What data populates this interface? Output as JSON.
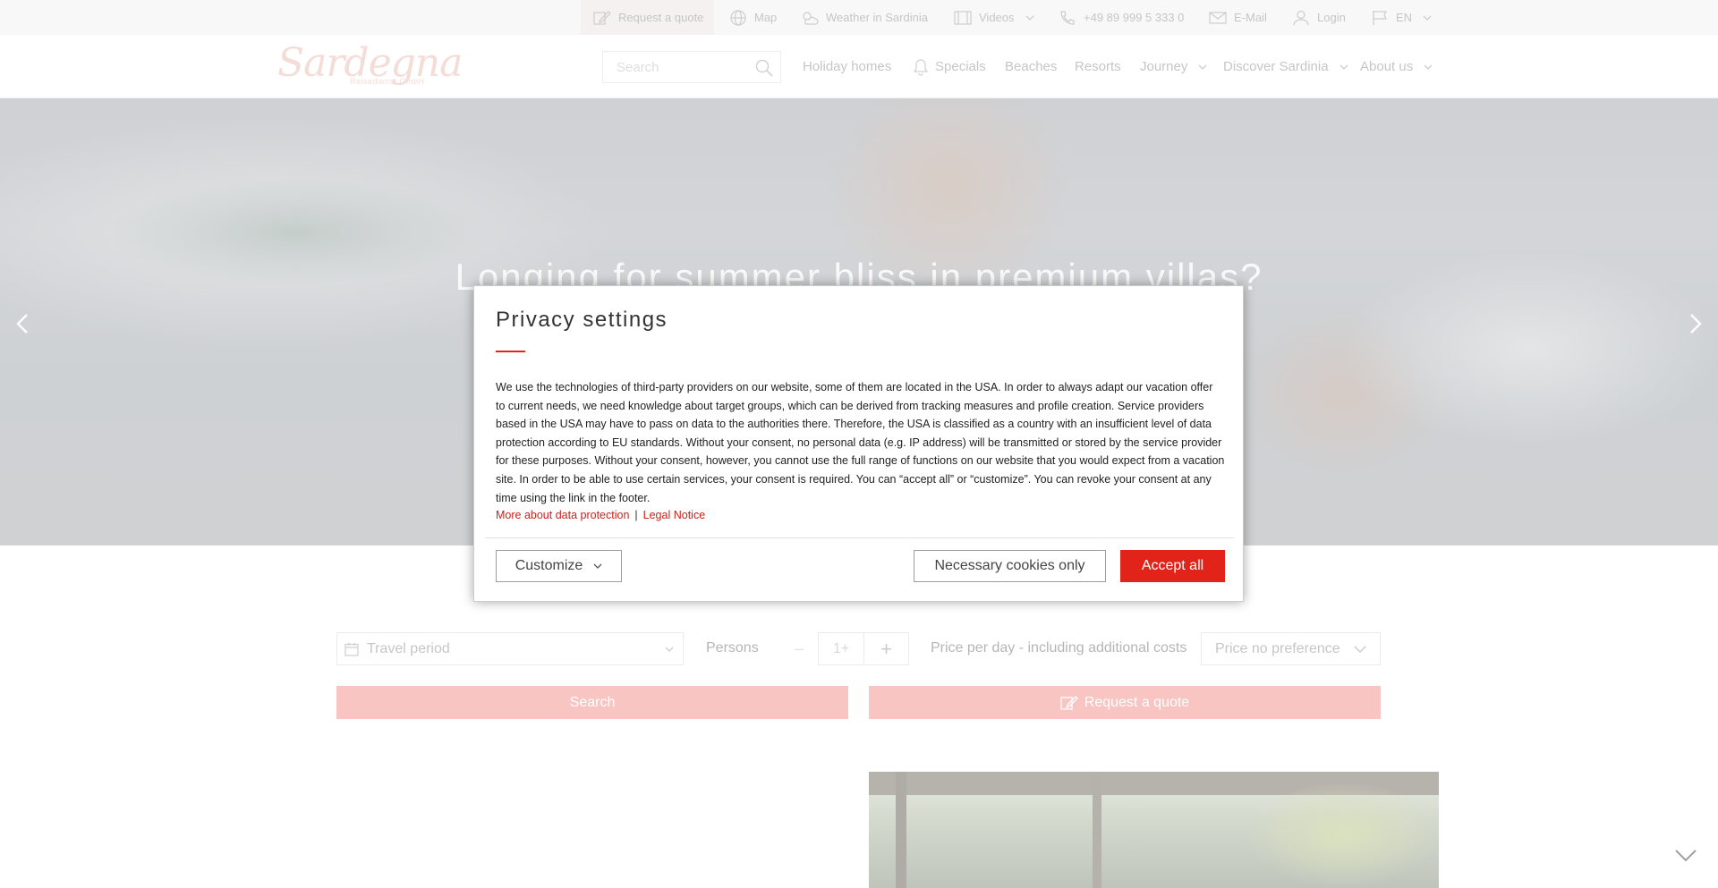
{
  "topbar": {
    "request_quote": "Request a quote",
    "map": "Map",
    "weather": "Weather in Sardinia",
    "videos": "Videos",
    "phone": "+49 89 999 5 333 0",
    "email": "E-Mail",
    "login": "Login",
    "language": "EN"
  },
  "header": {
    "logo_text": "Sardegna",
    "logo_sub": "Reisedienst GmbH",
    "search_placeholder": "Search",
    "nav": {
      "holiday_homes": "Holiday homes",
      "specials": "Specials",
      "beaches": "Beaches",
      "resorts": "Resorts",
      "journey": "Journey",
      "discover": "Discover Sardinia",
      "about": "About us"
    }
  },
  "hero": {
    "headline": "Longing for summer bliss in premium villas?"
  },
  "booking": {
    "travel_period": "Travel period",
    "persons_label": "Persons",
    "minus": "–",
    "persons_value": "1+",
    "plus": "+",
    "price_label": "Price per day - including additional costs",
    "price_select": "Price no preference",
    "search_button": "Search",
    "quote_button": "Request a quote"
  },
  "modal": {
    "title": "Privacy settings",
    "body": "We use the technologies of third-party providers on our website, some of them are located in the USA. In order to always adapt our vacation offer to current needs, we need knowledge about target groups, which can be derived from tracking measures and profile creation. Service providers based in the USA may have to pass on data to the authorities there. Therefore, the USA is classified as a country with an insufficient level of data protection according to EU standards. Without your consent, no personal data (e.g. IP address) will be transmitted or stored by the service provider for these purposes. Without your consent, however, you cannot use the full range of functions on our website that you would expect from a vacation site. In order to be able to use certain services, your consent is required. You can “accept all” or “customize”. You can revoke your consent at any time using the link in the footer.",
    "link_data_protection": "More about data protection",
    "link_separator": "|",
    "link_legal": "Legal Notice",
    "customize": "Customize",
    "necessary": "Necessary cookies only",
    "accept": "Accept all"
  },
  "colors": {
    "accent_red": "#e2231a",
    "button_pink": "#f08a86",
    "logo_pink": "#e9b8ae"
  }
}
